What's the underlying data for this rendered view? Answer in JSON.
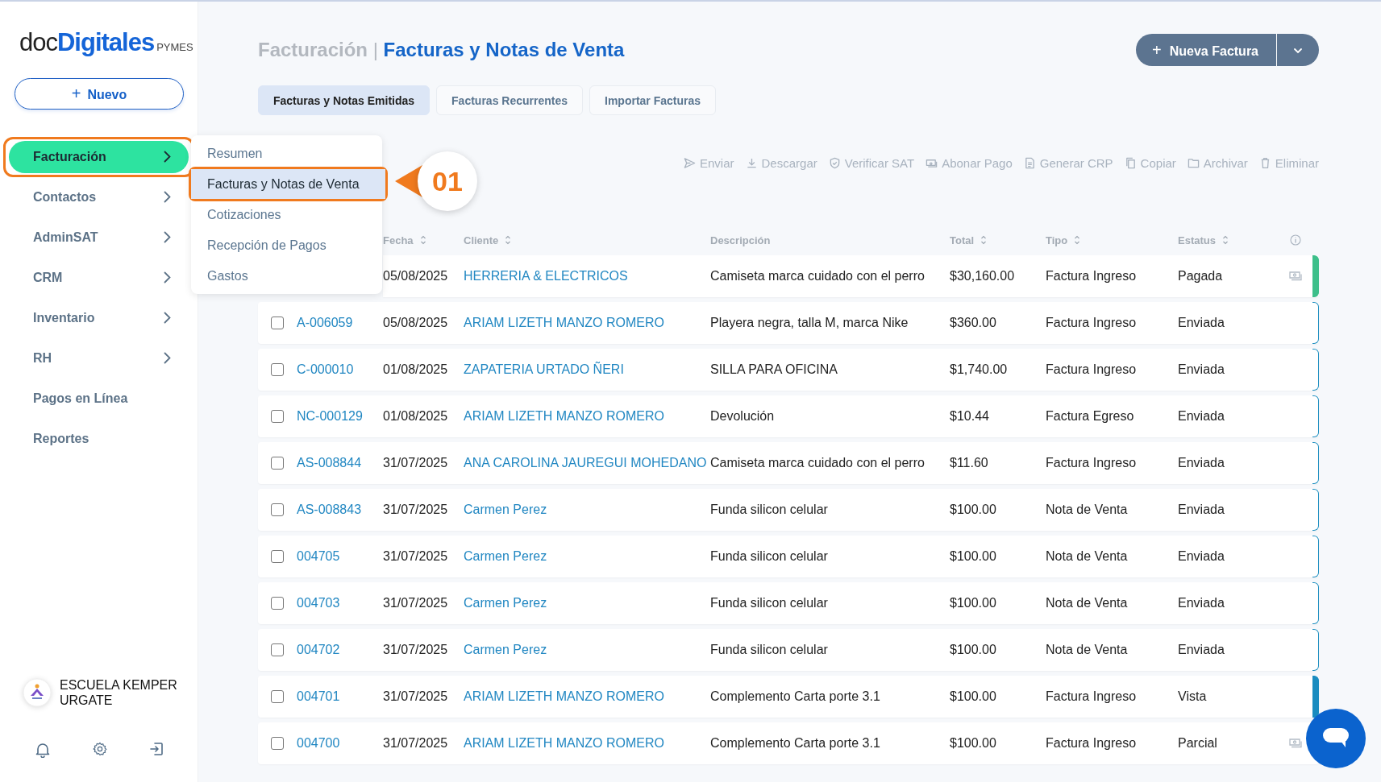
{
  "sidebar": {
    "logo": {
      "part_1": "doc",
      "part_2": "Digitales",
      "part_3": "PYMES"
    },
    "new_button": {
      "icon": "+",
      "label": "Nuevo"
    },
    "items": [
      {
        "label": "Facturación",
        "has_children": true,
        "selected": true,
        "highlighted": true
      },
      {
        "label": "Contactos",
        "has_children": true,
        "selected": false,
        "highlighted": false
      },
      {
        "label": "AdminSAT",
        "has_children": true,
        "selected": false,
        "highlighted": false
      },
      {
        "label": "CRM",
        "has_children": true,
        "selected": false,
        "highlighted": false
      },
      {
        "label": "Inventario",
        "has_children": true,
        "selected": false,
        "highlighted": false
      },
      {
        "label": "RH",
        "has_children": true,
        "selected": false,
        "highlighted": false
      },
      {
        "label": "Pagos en Línea",
        "has_children": false,
        "selected": false,
        "highlighted": false
      },
      {
        "label": "Reportes",
        "has_children": false,
        "selected": false,
        "highlighted": false
      }
    ],
    "organization": {
      "name": "ESCUELA KEMPER URGATE"
    }
  },
  "submenu": {
    "items": [
      {
        "label": "Resumen",
        "selected": false,
        "highlighted": false
      },
      {
        "label": "Facturas y Notas de Venta",
        "selected": true,
        "highlighted": true
      },
      {
        "label": "Cotizaciones",
        "selected": false,
        "highlighted": false
      },
      {
        "label": "Recepción de Pagos",
        "selected": false,
        "highlighted": false
      },
      {
        "label": "Gastos",
        "selected": false,
        "highlighted": false
      }
    ]
  },
  "callout": {
    "label": "01"
  },
  "header": {
    "section": "Facturación",
    "separator": "|",
    "title": "Facturas y Notas de Venta",
    "primary_button": {
      "icon": "+",
      "label": "Nueva Factura"
    }
  },
  "tabs": [
    {
      "label": "Facturas y Notas Emitidas",
      "selected": true
    },
    {
      "label": "Facturas Recurrentes",
      "selected": false
    },
    {
      "label": "Importar Facturas",
      "selected": false
    }
  ],
  "actions": [
    {
      "kind": "send",
      "label": "Enviar"
    },
    {
      "kind": "download",
      "label": "Descargar"
    },
    {
      "kind": "verify",
      "label": "Verificar SAT"
    },
    {
      "kind": "payment",
      "label": "Abonar Pago"
    },
    {
      "kind": "document",
      "label": "Generar CRP"
    },
    {
      "kind": "copy",
      "label": "Copiar"
    },
    {
      "kind": "archive",
      "label": "Archivar"
    },
    {
      "kind": "delete",
      "label": "Eliminar"
    }
  ],
  "table": {
    "columns": [
      {
        "label": "Fecha",
        "sortable": true
      },
      {
        "label": "Cliente",
        "sortable": true
      },
      {
        "label": "Descripción",
        "sortable": false
      },
      {
        "label": "Total",
        "sortable": true
      },
      {
        "label": "Tipo",
        "sortable": true
      },
      {
        "label": "Estatus",
        "sortable": true
      }
    ],
    "rows": [
      {
        "fecha": "05/08/2025",
        "cliente": "HERRERIA & ELECTRICOS",
        "descripcion": "Camiseta marca cuidado con el perro",
        "total": "$30,160.00",
        "tipo": "Factura Ingreso",
        "estatus": "Pagada",
        "payment_icon": true,
        "bar": {
          "color": "#3dbf8a",
          "filled": true
        }
      },
      {
        "checked": false,
        "folio": "A-006059",
        "fecha": "05/08/2025",
        "cliente": "ARIAM LIZETH MANZO ROMERO",
        "descripcion": "Playera negra, talla M, marca Nike",
        "total": "$360.00",
        "tipo": "Factura Ingreso",
        "estatus": "Enviada",
        "payment_icon": false,
        "bar": {
          "color": "#1f8fc0",
          "filled": false
        }
      },
      {
        "checked": false,
        "folio": "C-000010",
        "fecha": "01/08/2025",
        "cliente": "ZAPATERIA URTADO ÑERI",
        "descripcion": "SILLA PARA OFICINA",
        "total": "$1,740.00",
        "tipo": "Factura Ingreso",
        "estatus": "Enviada",
        "payment_icon": false,
        "bar": {
          "color": "#1f8fc0",
          "filled": false
        }
      },
      {
        "checked": false,
        "folio": "NC-000129",
        "fecha": "01/08/2025",
        "cliente": "ARIAM LIZETH MANZO ROMERO",
        "descripcion": "Devolución",
        "total": "$10.44",
        "tipo": "Factura Egreso",
        "estatus": "Enviada",
        "payment_icon": false,
        "bar": {
          "color": "#1f8fc0",
          "filled": false
        }
      },
      {
        "checked": false,
        "folio": "AS-008844",
        "fecha": "31/07/2025",
        "cliente": "ANA CAROLINA JAUREGUI MOHEDANO",
        "descripcion": "Camiseta marca cuidado con el perro",
        "total": "$11.60",
        "tipo": "Factura Ingreso",
        "estatus": "Enviada",
        "payment_icon": false,
        "bar": {
          "color": "#1f8fc0",
          "filled": false
        }
      },
      {
        "checked": false,
        "folio": "AS-008843",
        "fecha": "31/07/2025",
        "cliente": "Carmen Perez",
        "descripcion": "Funda silicon celular",
        "total": "$100.00",
        "tipo": "Nota de Venta",
        "estatus": "Enviada",
        "payment_icon": false,
        "bar": {
          "color": "#1f8fc0",
          "filled": false
        }
      },
      {
        "checked": false,
        "folio": "004705",
        "fecha": "31/07/2025",
        "cliente": "Carmen Perez",
        "descripcion": "Funda silicon celular",
        "total": "$100.00",
        "tipo": "Nota de Venta",
        "estatus": "Enviada",
        "payment_icon": false,
        "bar": {
          "color": "#1f8fc0",
          "filled": false
        }
      },
      {
        "checked": false,
        "folio": "004703",
        "fecha": "31/07/2025",
        "cliente": "Carmen Perez",
        "descripcion": "Funda silicon celular",
        "total": "$100.00",
        "tipo": "Nota de Venta",
        "estatus": "Enviada",
        "payment_icon": false,
        "bar": {
          "color": "#1f8fc0",
          "filled": false
        }
      },
      {
        "checked": false,
        "folio": "004702",
        "fecha": "31/07/2025",
        "cliente": "Carmen Perez",
        "descripcion": "Funda silicon celular",
        "total": "$100.00",
        "tipo": "Nota de Venta",
        "estatus": "Enviada",
        "payment_icon": false,
        "bar": {
          "color": "#1f8fc0",
          "filled": false
        }
      },
      {
        "checked": false,
        "folio": "004701",
        "fecha": "31/07/2025",
        "cliente": "ARIAM LIZETH MANZO ROMERO",
        "descripcion": "Complemento Carta porte 3.1",
        "total": "$100.00",
        "tipo": "Factura Ingreso",
        "estatus": "Vista",
        "payment_icon": false,
        "bar": {
          "color": "#1a8cc0",
          "filled": true
        }
      },
      {
        "checked": false,
        "folio": "004700",
        "fecha": "31/07/2025",
        "cliente": "ARIAM LIZETH MANZO ROMERO",
        "descripcion": "Complemento Carta porte 3.1",
        "total": "$100.00",
        "tipo": "Factura Ingreso",
        "estatus": "Parcial",
        "payment_icon": true
      }
    ]
  }
}
